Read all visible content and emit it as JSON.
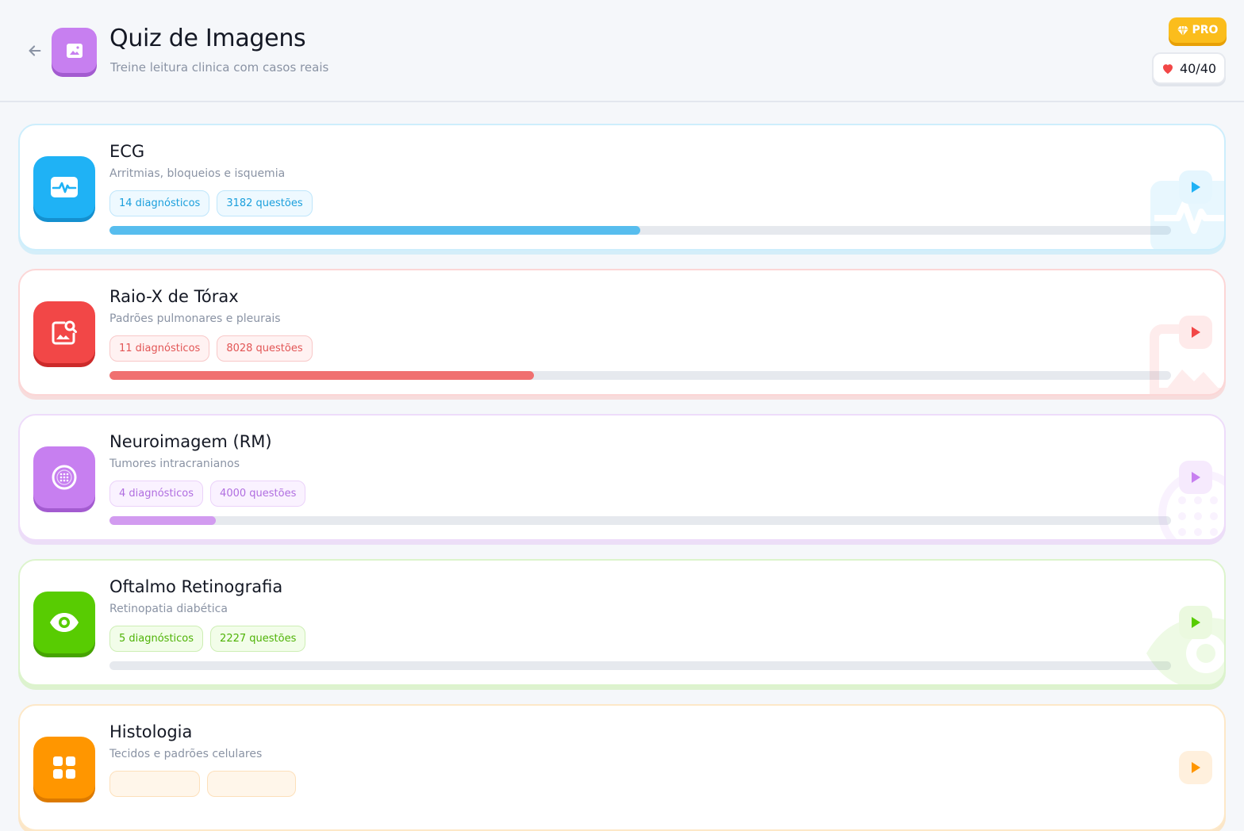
{
  "header": {
    "title": "Quiz de Imagens",
    "subtitle": "Treine leitura clinica com casos reais",
    "pro_label": "PRO",
    "lives": "40/40"
  },
  "colors": {
    "ecg": "#1fb2f5",
    "raio_x": "#f24747",
    "neuro": "#c77ff0",
    "oftalmo": "#58cc02",
    "histologia": "#ff9600"
  },
  "cards": [
    {
      "title": "ECG",
      "subtitle": "Arritmias, bloqueios e isquemia",
      "chip_diagnosticos": "14 diagnósticos",
      "chip_questoes": "3182 questões",
      "progress_fraction": 0.5,
      "icon": "heart-rate-monitor-icon"
    },
    {
      "title": "Raio-X de Tórax",
      "subtitle": "Padrões pulmonares e pleurais",
      "chip_diagnosticos": "11 diagnósticos",
      "chip_questoes": "8028 questões",
      "progress_fraction": 0.4,
      "icon": "image-search-icon"
    },
    {
      "title": "Neuroimagem (RM)",
      "subtitle": "Tumores intracranianos",
      "chip_diagnosticos": "4 diagnósticos",
      "chip_questoes": "4000 questões",
      "progress_fraction": 0.1,
      "icon": "brain-scan-icon"
    },
    {
      "title": "Oftalmo Retinografia",
      "subtitle": "Retinopatia diabética",
      "chip_diagnosticos": "5 diagnósticos",
      "chip_questoes": "2227 questões",
      "progress_fraction": 0,
      "icon": "eye-icon"
    },
    {
      "title": "Histologia",
      "subtitle": "Tecidos e padrões celulares",
      "chip_diagnosticos": "",
      "chip_questoes": "",
      "progress_fraction": 0,
      "icon": "grid-icon"
    }
  ]
}
